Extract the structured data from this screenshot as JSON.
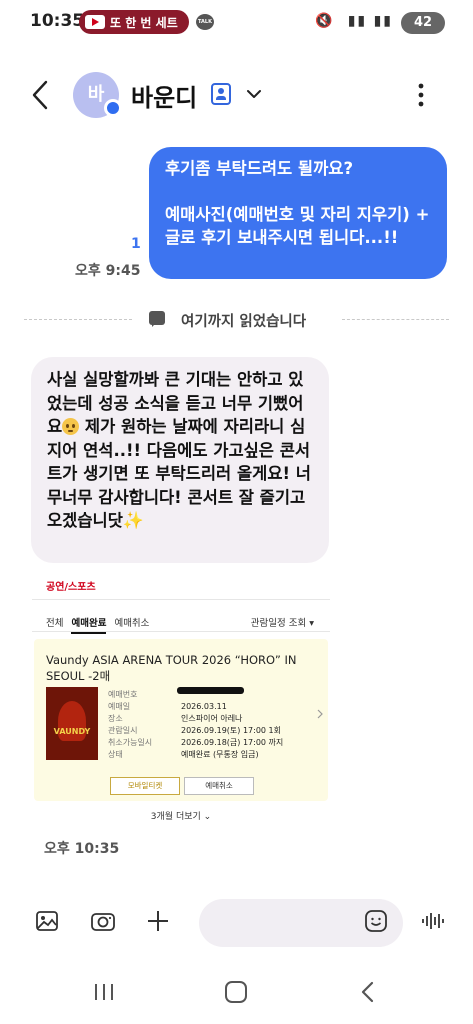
{
  "status_bar": {
    "time": "10:35",
    "notification_pill": "또 한 번 세트",
    "talk_badge": "TALK",
    "battery": "42",
    "pill_color": "#8b1a2b"
  },
  "header": {
    "contact_name": "바운디",
    "avatar_initial": "바",
    "avatar_color": "#b9bff0"
  },
  "outgoing": {
    "text": "후기좀 부탁드려도 될까요?\n\n예매사진(예매번호 및 자리 지우기) + 글로 후기 보내주시면 됩니다...!!",
    "unread_count": "1",
    "time": "오후 9:45",
    "bubble_color": "#3d74f0"
  },
  "read_divider": {
    "text": "여기까지 읽었습니다"
  },
  "incoming": {
    "text_part1": "사실 실망할까봐 큰 기대는 안하고 있었는데 성공 소식을 듣고 너무 기뻤어요",
    "text_part2": " 제가 원하는 날짜에 자리라니 심지어 연석..!! 다음에도 가고싶은 콘서트가 생기면 또 부탁드리러 올게요! 너무너무 감사합니다! 콘서트 잘 즐기고 오겠습니닷",
    "sparkle": "✨",
    "time": "오후 10:35"
  },
  "ticket_image": {
    "category": "공연/스포츠",
    "tabs": [
      "전체",
      "예매완료",
      "예매취소"
    ],
    "active_tab": "예매완료",
    "sort_label": "관람일정 조회",
    "title": "Vaundy ASIA ARENA TOUR 2026 “HORO” IN SEOUL -2매",
    "poster_label": "VAUNDY",
    "labels": [
      "예매번호",
      "예매일",
      "장소",
      "관람일시",
      "취소가능일시",
      "상태"
    ],
    "values": [
      "",
      "2026.03.11",
      "인스파이어 아레나",
      "2026.09.19(토) 17:00 1회",
      "2026.09.18(금) 17:00 까지",
      "예매완료 (무통장 입금)"
    ],
    "btn_mobile": "모바일티켓",
    "btn_cancel": "예매취소",
    "more": "3개월 더보기"
  },
  "input_bar": {
    "placeholder": ""
  },
  "icons": [
    "back-icon",
    "more-icon",
    "gallery-icon",
    "camera-icon",
    "plus-icon",
    "emoji-icon",
    "voice-icon"
  ]
}
